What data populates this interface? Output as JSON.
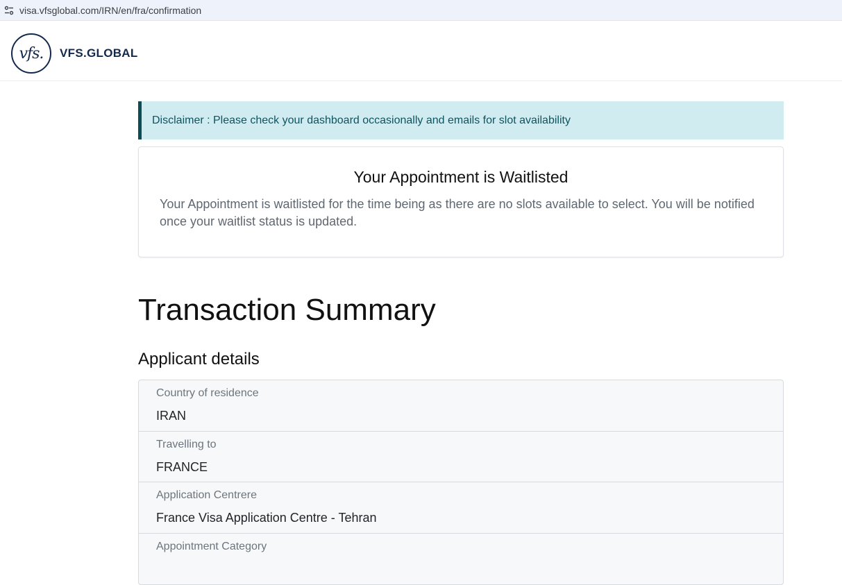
{
  "browser": {
    "url": "visa.vfsglobal.com/IRN/en/fra/confirmation",
    "site_info_icon": "tune-icon"
  },
  "header": {
    "logo_text": "vfs.",
    "brand_name": "VFS.GLOBAL"
  },
  "disclaimer": {
    "text": "Disclaimer : Please check your dashboard occasionally and emails for slot availability"
  },
  "waitlist": {
    "title": "Your Appointment is Waitlisted",
    "message": "Your Appointment is waitlisted for the time being as there are no slots available to select. You will be notified once your waitlist status is updated."
  },
  "summary": {
    "title": "Transaction Summary",
    "section_title": "Applicant details",
    "rows": [
      {
        "label": "Country of residence",
        "value": "IRAN"
      },
      {
        "label": "Travelling to",
        "value": "FRANCE"
      },
      {
        "label": "Application Centrere",
        "value": "France Visa Application Centre - Tehran"
      },
      {
        "label": "Appointment Category",
        "value": ""
      }
    ]
  },
  "colors": {
    "brand_navy": "#13294b",
    "disclaimer_bg": "#d1ecf1",
    "disclaimer_border": "#0b4d52"
  }
}
